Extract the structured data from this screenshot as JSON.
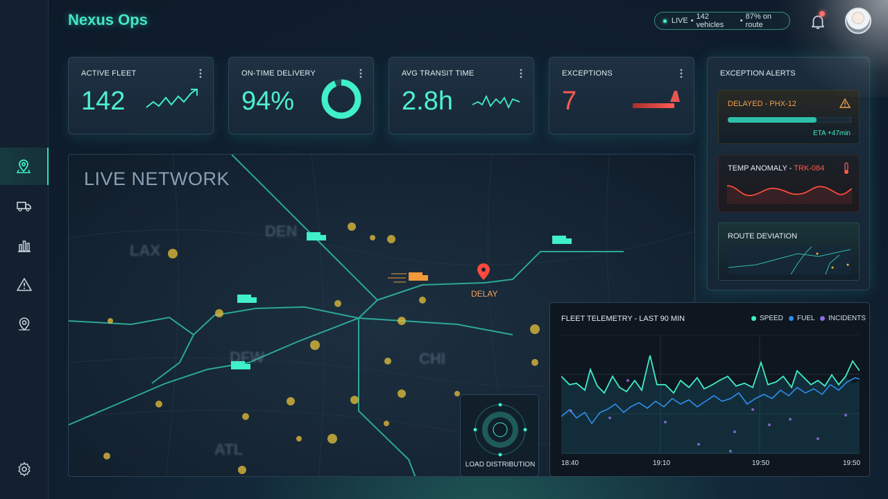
{
  "app": {
    "title": "Nexus Ops"
  },
  "status": {
    "live_label": "LIVE",
    "vehicles": "142 vehicles",
    "on_route": "87% on route",
    "sep": "•"
  },
  "sidebar": {
    "items": [
      {
        "icon": "map-pin-icon",
        "active": true
      },
      {
        "icon": "truck-icon",
        "active": false
      },
      {
        "icon": "bar-chart-icon",
        "active": false
      },
      {
        "icon": "warning-icon",
        "active": false
      },
      {
        "icon": "location-target-icon",
        "active": false
      }
    ],
    "footer_icon": "gear-icon"
  },
  "kpis": [
    {
      "label": "ACTIVE FLEET",
      "value": "142"
    },
    {
      "label": "ON-TIME DELIVERY",
      "value": "94%",
      "ring_fraction": 0.94
    },
    {
      "label": "AVG TRANSIT TIME",
      "value": "2.8h"
    },
    {
      "label": "EXCEPTIONS",
      "value": "7"
    }
  ],
  "map": {
    "title": "LIVE NETWORK",
    "cities": [
      "LAX",
      "DEN",
      "CHI",
      "DFW",
      "ATL"
    ],
    "delay_label": "DELAY",
    "load_distribution_label": "LOAD DISTRIBUTION"
  },
  "alerts": {
    "heading": "EXCEPTION ALERTS",
    "items": [
      {
        "title": "DELAYED - PHX-12",
        "eta": "ETA +47min",
        "progress": 0.72,
        "color": "#f0a24a"
      },
      {
        "title_prefix": "TEMP ANOMALY - ",
        "title_id": "TRK-084",
        "color": "#ff5a4f"
      },
      {
        "title": "ROUTE DEVIATION"
      }
    ]
  },
  "telemetry": {
    "title": "FLEET TELEMETRY - LAST 90 MIN",
    "legend": [
      {
        "name": "SPEED",
        "color": "#3ff0c8"
      },
      {
        "name": "FUEL",
        "color": "#2f8ff0"
      },
      {
        "name": "INCIDENTS",
        "color": "#8a6fe0"
      }
    ],
    "x_ticks": [
      "18:40",
      "19:10",
      "19:50",
      "19:50"
    ]
  },
  "colors": {
    "accent": "#3ff0c8",
    "danger": "#ff5b52",
    "warning": "#f0a24a"
  }
}
